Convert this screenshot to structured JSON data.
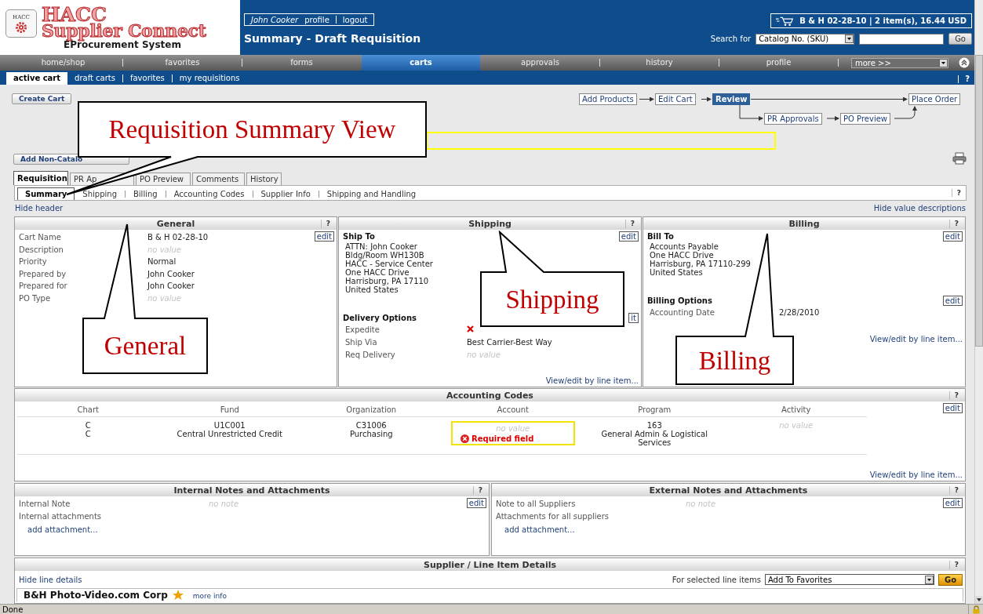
{
  "header": {
    "logo": {
      "badge": "HACC",
      "line1": "HACC",
      "line2": "Supplier Connect",
      "tagline": "EProcurement System"
    },
    "user": {
      "name": "John Cooker",
      "links": [
        "profile",
        "logout"
      ]
    },
    "page_title": "Summary - Draft Requisition",
    "cart": "B & H 02-28-10 | 2 item(s), 16.44 USD",
    "search": {
      "label": "Search for",
      "scope": "Catalog No. (SKU)",
      "button": "Go"
    }
  },
  "main_tabs": [
    {
      "label": "home/shop",
      "selected": false
    },
    {
      "label": "favorites",
      "selected": false
    },
    {
      "label": "forms",
      "selected": false
    },
    {
      "label": "carts",
      "selected": true
    },
    {
      "label": "approvals",
      "selected": false
    },
    {
      "label": "history",
      "selected": false
    },
    {
      "label": "profile",
      "selected": false
    }
  ],
  "more_menu": "more >>",
  "sub_tabs": [
    {
      "label": "active cart",
      "selected": true
    },
    {
      "label": "draft carts",
      "selected": false
    },
    {
      "label": "favorites",
      "selected": false
    },
    {
      "label": "my requisitions",
      "selected": false
    }
  ],
  "sub_help": "?",
  "toolbar": {
    "create_cart": "Create Cart",
    "add_non_catalog": "Add Non-Catalo"
  },
  "workflow": [
    {
      "label": "Add Products",
      "selected": false
    },
    {
      "label": "Edit Cart",
      "selected": false
    },
    {
      "label": "Review",
      "selected": true
    },
    {
      "label": "PR Approvals",
      "selected": false
    },
    {
      "label": "PO Preview",
      "selected": false
    },
    {
      "label": "Place Order",
      "selected": false
    }
  ],
  "doc_tabs": [
    {
      "label": "Requisition",
      "selected": true
    },
    {
      "label": "PR Ap",
      "selected": false
    },
    {
      "label": "PO Preview",
      "selected": false
    },
    {
      "label": "Comments",
      "selected": false
    },
    {
      "label": "History",
      "selected": false
    }
  ],
  "section_tabs": [
    {
      "label": "Summary",
      "selected": true
    },
    {
      "label": "Shipping",
      "selected": false
    },
    {
      "label": "Billing",
      "selected": false
    },
    {
      "label": "Accounting Codes",
      "selected": false
    },
    {
      "label": "Supplier Info",
      "selected": false
    },
    {
      "label": "Shipping and Handling",
      "selected": false
    }
  ],
  "section_help": "?",
  "links": {
    "hide_header": "Hide header",
    "hide_descriptions": "Hide value descriptions"
  },
  "general": {
    "title": "General",
    "help": "?",
    "edit": "edit",
    "fields": [
      {
        "label": "Cart Name",
        "value": "B & H 02-28-10",
        "empty": false
      },
      {
        "label": "Description",
        "value": "no value",
        "empty": true
      },
      {
        "label": "Priority",
        "value": "Normal",
        "empty": false
      },
      {
        "label": "Prepared by",
        "value": "John Cooker",
        "empty": false
      },
      {
        "label": "Prepared for",
        "value": "John Cooker",
        "empty": false
      },
      {
        "label": "PO Type",
        "value": "no value",
        "empty": true
      }
    ]
  },
  "shipping": {
    "title": "Shipping",
    "help": "?",
    "ship_to": "Ship To",
    "edit": "edit",
    "address": [
      "ATTN: John Cooker",
      "Bldg/Room WH130B",
      "HACC - Service Center",
      "One HACC Drive",
      "Harrisburg, PA 17110",
      "United States"
    ],
    "delivery_title": "Delivery Options",
    "delivery_edit": "it",
    "expedite": {
      "label": "Expedite",
      "checked": false
    },
    "fields": [
      {
        "label": "Ship Via",
        "value": "Best Carrier-Best Way",
        "empty": false
      },
      {
        "label": "Req Delivery",
        "value": "no value",
        "empty": true
      }
    ],
    "link": "View/edit by line item..."
  },
  "billing": {
    "title": "Billing",
    "help": "?",
    "bill_to": "Bill To",
    "edit": "edit",
    "address": [
      "Accounts Payable",
      "One HACC Drive",
      "Harrisburg, PA 17110-299",
      "United States"
    ],
    "options_title": "Billing Options",
    "options_edit": "edit",
    "fields": [
      {
        "label": "Accounting Date",
        "value": "2/28/2010",
        "empty": false
      }
    ],
    "link": "View/edit by line item..."
  },
  "accounting": {
    "title": "Accounting Codes",
    "help": "?",
    "edit": "edit",
    "columns": [
      "Chart",
      "Fund",
      "Organization",
      "Account",
      "Program",
      "Activity"
    ],
    "cells": [
      {
        "lines": [
          "C",
          "C"
        ],
        "empty": false
      },
      {
        "lines": [
          "U1C001",
          "Central Unrestricted Credit"
        ],
        "empty": false
      },
      {
        "lines": [
          "C31006",
          "Purchasing"
        ],
        "empty": false
      },
      {
        "lines": [
          "no value"
        ],
        "empty": true,
        "error": "Required field"
      },
      {
        "lines": [
          "163",
          "General Admin & Logistical Services"
        ],
        "empty": false
      },
      {
        "lines": [
          "no value"
        ],
        "empty": true
      }
    ],
    "link": "View/edit by line item..."
  },
  "internal_notes": {
    "title": "Internal Notes and Attachments",
    "help": "?",
    "edit": "edit",
    "fields": [
      {
        "label": "Internal Note",
        "value": "no note",
        "empty": true
      },
      {
        "label": "Internal attachments"
      }
    ],
    "link": "add attachment..."
  },
  "external_notes": {
    "title": "External Notes and Attachments",
    "help": "?",
    "edit": "edit",
    "fields": [
      {
        "label": "Note to all Suppliers",
        "value": "no note",
        "empty": true
      },
      {
        "label": "Attachments for all suppliers"
      }
    ],
    "link": "add attachment..."
  },
  "supplier": {
    "title": "Supplier / Line Item Details",
    "help": "?",
    "hide": "Hide line details",
    "action_label": "For selected line items",
    "action": "Add To Favorites",
    "go": "Go",
    "name": "B&H Photo-Video.com Corp",
    "more": "more info"
  },
  "callouts": [
    {
      "text": "Requisition Summary View"
    },
    {
      "text": "General"
    },
    {
      "text": "Shipping"
    },
    {
      "text": "Billing"
    }
  ],
  "status": "Done"
}
